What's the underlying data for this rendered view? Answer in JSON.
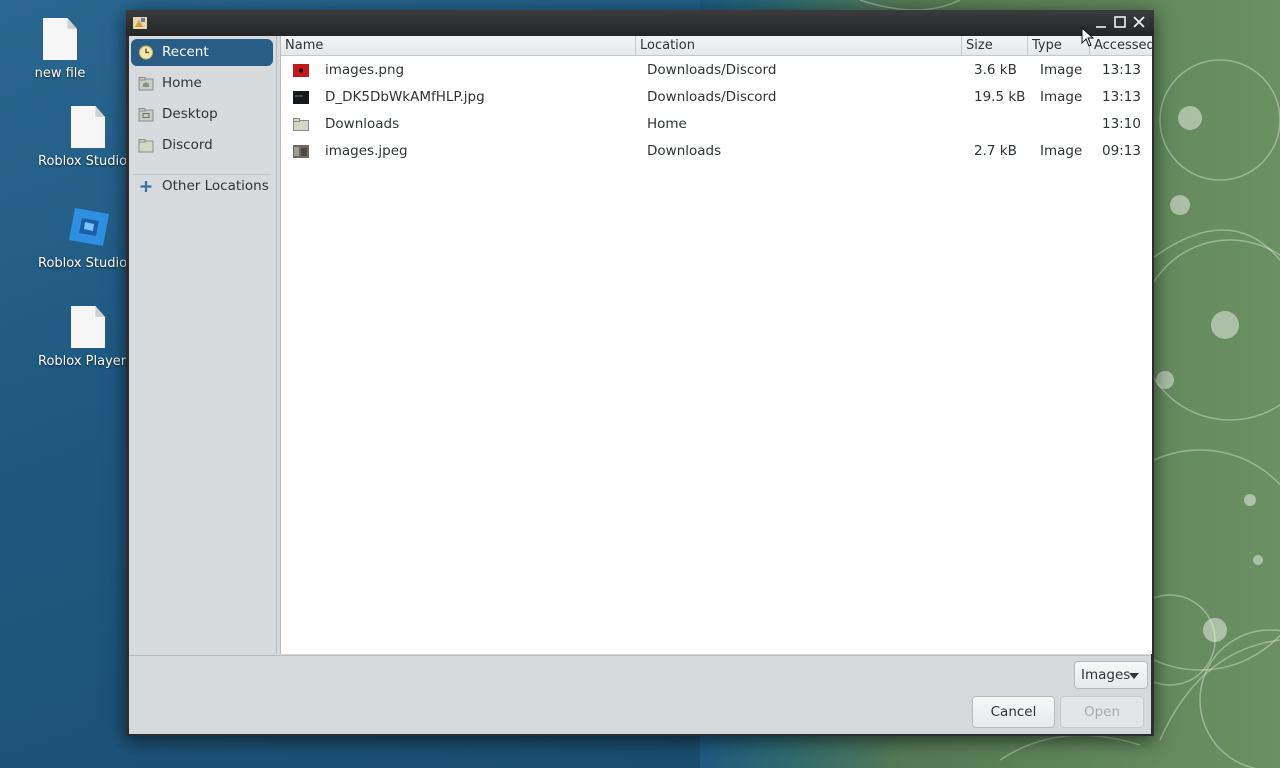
{
  "desktop": {
    "icons": [
      {
        "label": "new file",
        "kind": "file-icon"
      },
      {
        "label": "Roblox Studio.",
        "kind": "file-icon"
      },
      {
        "label": "Roblox Studio",
        "kind": "roblox-studio-icon"
      },
      {
        "label": "Roblox Player.",
        "kind": "file-icon"
      }
    ]
  },
  "dialog": {
    "title": "",
    "sidebar": {
      "items": [
        {
          "label": "Recent",
          "icon": "clock-icon",
          "active": true
        },
        {
          "label": "Home",
          "icon": "home-folder-icon"
        },
        {
          "label": "Desktop",
          "icon": "desktop-folder-icon"
        },
        {
          "label": "Discord",
          "icon": "folder-icon"
        },
        {
          "label": "Other Locations",
          "icon": "plus-icon"
        }
      ]
    },
    "columns": {
      "name": "Name",
      "location": "Location",
      "size": "Size",
      "type": "Type",
      "accessed": "Accessed"
    },
    "files": [
      {
        "name": "images.png",
        "location": "Downloads/Discord",
        "size": "3.6 kB",
        "type": "Image",
        "accessed": "13:13",
        "icon": "red-image-thumb-icon"
      },
      {
        "name": "D_DK5DbWkAMfHLP.jpg",
        "location": "Downloads/Discord",
        "size": "19.5 kB",
        "type": "Image",
        "accessed": "13:13",
        "icon": "dark-image-thumb-icon"
      },
      {
        "name": "Downloads",
        "location": "Home",
        "size": "",
        "type": "",
        "accessed": "13:10",
        "icon": "folder-icon"
      },
      {
        "name": "images.jpeg",
        "location": "Downloads",
        "size": "2.7 kB",
        "type": "Image",
        "accessed": "09:13",
        "icon": "photo-thumb-icon"
      }
    ],
    "filter": {
      "label": "Images"
    },
    "buttons": {
      "cancel": "Cancel",
      "open": "Open"
    }
  },
  "colors": {
    "selection": "#2a5d86",
    "desktop_blue": "#1f5a82",
    "wallpaper_green": "#5d8459"
  }
}
